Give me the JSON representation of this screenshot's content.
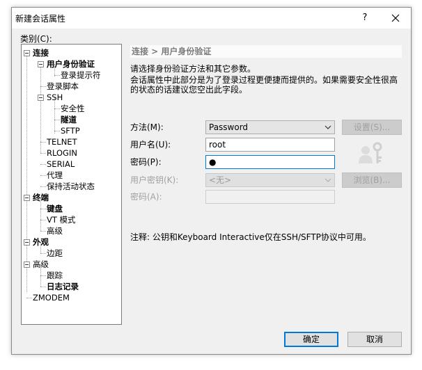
{
  "window": {
    "title": "新建会话属性",
    "help_label": "?"
  },
  "category_label": "类别(C):",
  "tree": [
    {
      "label": "连接",
      "bold": true
    },
    {
      "label": "用户身份验证",
      "bold": true
    },
    {
      "label": "登录提示符",
      "bold": false
    },
    {
      "label": "登录脚本",
      "bold": false
    },
    {
      "label": "SSH",
      "bold": false
    },
    {
      "label": "安全性",
      "bold": false
    },
    {
      "label": "隧道",
      "bold": true
    },
    {
      "label": "SFTP",
      "bold": false
    },
    {
      "label": "TELNET",
      "bold": false
    },
    {
      "label": "RLOGIN",
      "bold": false
    },
    {
      "label": "SERIAL",
      "bold": false
    },
    {
      "label": "代理",
      "bold": false
    },
    {
      "label": "保持活动状态",
      "bold": false
    },
    {
      "label": "终端",
      "bold": true
    },
    {
      "label": "键盘",
      "bold": true
    },
    {
      "label": "VT 模式",
      "bold": false
    },
    {
      "label": "高级",
      "bold": false
    },
    {
      "label": "外观",
      "bold": true
    },
    {
      "label": "边距",
      "bold": false
    },
    {
      "label": "高级",
      "bold": false
    },
    {
      "label": "跟踪",
      "bold": false
    },
    {
      "label": "日志记录",
      "bold": true
    },
    {
      "label": "ZMODEM",
      "bold": false
    }
  ],
  "panel": {
    "header": "连接 > 用户身份验证",
    "description_1": "请选择身份验证方法和其它参数。",
    "description_2": "会话属性中此部分是为了登录过程更便捷而提供的。如果需要安全性很高的状态的话建议您空出此字段。",
    "method_label": "方法(M):",
    "method_value": "Password",
    "settings_button": "设置(S)...",
    "username_label": "用户名(U):",
    "username_value": "root",
    "password_label": "密码(P):",
    "password_value": "●",
    "userkey_label": "用户密钥(K):",
    "userkey_value": "<无>",
    "browse_button": "浏览(B)...",
    "passphrase_label": "密码(A):",
    "note": "注释: 公钥和Keyboard Interactive仅在SSH/SFTP协议中可用。"
  },
  "footer": {
    "ok_label": "确定",
    "cancel_label": "取消"
  },
  "icons": {
    "close": "close-icon",
    "chevron": "chevron-down-icon",
    "user_key": "user-key-icon"
  }
}
